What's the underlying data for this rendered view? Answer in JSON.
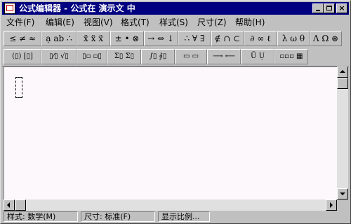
{
  "window": {
    "title": "公式编辑器 - 公式在 演示文 中",
    "icon": "equation-editor-icon",
    "buttons": {
      "minimize": "minimize-icon",
      "maximize": "maximize-icon",
      "close": "×"
    }
  },
  "menubar": {
    "items": [
      {
        "label": "文件(F)"
      },
      {
        "label": "编辑(E)"
      },
      {
        "label": "视图(V)"
      },
      {
        "label": "格式(T)"
      },
      {
        "label": "样式(S)"
      },
      {
        "label": "尺寸(Z)"
      },
      {
        "label": "帮助(H)"
      }
    ]
  },
  "toolbar_symbols": [
    {
      "label": "≤ ≠ ≈"
    },
    {
      "label": "ạ ab ∴"
    },
    {
      "label": "ẍ ẍ ẍ"
    },
    {
      "label": "± • ⊗"
    },
    {
      "label": "→ ⇔ ↓"
    },
    {
      "label": "∴ ∀ ∃"
    },
    {
      "label": "∉ ∩ ⊂"
    },
    {
      "label": "∂ ∞ ℓ"
    },
    {
      "label": "λ ω θ"
    },
    {
      "label": "Λ Ω ⊛"
    }
  ],
  "toolbar_templates": [
    {
      "label": "(▯) [▯]"
    },
    {
      "label": "▯⁄▯ √▯"
    },
    {
      "label": "▯▫ ▫▯"
    },
    {
      "label": "Σ▯ Σ▯"
    },
    {
      "label": "∫▯ ∮▯"
    },
    {
      "label": "▭ ▭"
    },
    {
      "label": "⟶ ⟵"
    },
    {
      "label": "Ū Ụ"
    },
    {
      "label": "▫▫▫ ▦"
    }
  ],
  "statusbar": {
    "style": "样式: 数学(M)",
    "size": "尺寸: 标准(F)",
    "zoom": "显示比例..."
  }
}
